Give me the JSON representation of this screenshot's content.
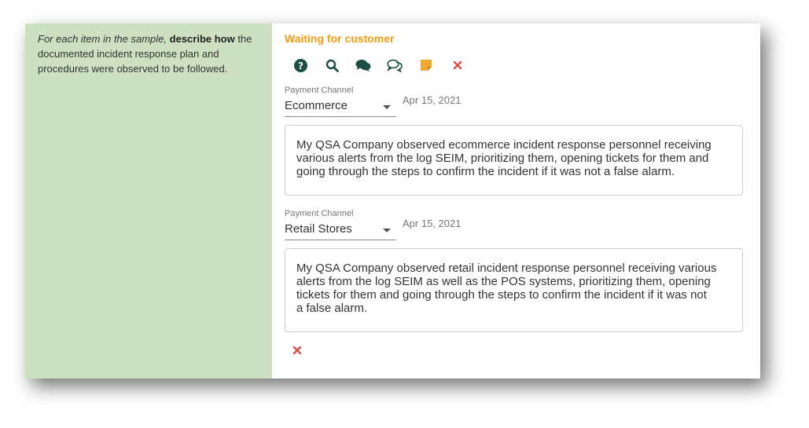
{
  "instructions": {
    "italic": "For each item in the sample,",
    "bold": "describe how",
    "rest": "the documented incident response plan and procedures were observed to be followed."
  },
  "status": "Waiting for customer",
  "toolbar": {
    "icons": [
      "help-icon",
      "search-icon",
      "comments-icon",
      "comment-outline-icon",
      "note-icon",
      "close-icon"
    ],
    "colors": {
      "dark": "#1c4f43",
      "note": "#f0a830",
      "close": "#d9534f"
    }
  },
  "entries": [
    {
      "field_label": "Payment Channel",
      "channel": "Ecommerce",
      "date": "Apr 15, 2021",
      "text": "My QSA Company observed ecommerce incident response personnel receiving\nvarious alerts from the log SEIM, prioritizing them, opening tickets for them and\ngoing through the steps to confirm the incident if it was not a false alarm."
    },
    {
      "field_label": "Payment Channel",
      "channel": "Retail Stores",
      "date": "Apr 15, 2021",
      "text": "My QSA Company observed retail incident response personnel receiving various\nalerts from the log SEIM as well as the POS systems, prioritizing them, opening\ntickets for them and going through the steps to confirm the incident if it was not\na false alarm."
    }
  ]
}
